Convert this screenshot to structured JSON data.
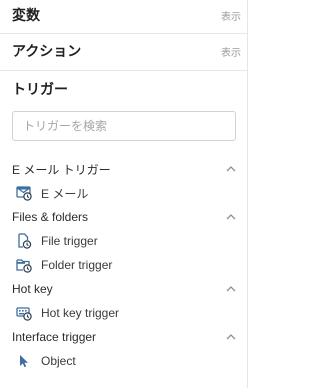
{
  "sections": {
    "variables": {
      "title": "変数",
      "toggle": "表示"
    },
    "actions": {
      "title": "アクション",
      "toggle": "表示"
    },
    "triggers": {
      "title": "トリガー"
    }
  },
  "search": {
    "placeholder": "トリガーを検索"
  },
  "groups": [
    {
      "title": "E メール トリガー",
      "items": [
        {
          "label": "E メール",
          "icon": "email-trigger-icon"
        }
      ]
    },
    {
      "title": "Files & folders",
      "items": [
        {
          "label": "File trigger",
          "icon": "file-trigger-icon"
        },
        {
          "label": "Folder trigger",
          "icon": "folder-trigger-icon"
        }
      ]
    },
    {
      "title": "Hot key",
      "items": [
        {
          "label": "Hot key trigger",
          "icon": "hotkey-trigger-icon"
        }
      ]
    },
    {
      "title": "Interface trigger",
      "items": [
        {
          "label": "Object",
          "icon": "object-trigger-icon"
        }
      ]
    }
  ],
  "colors": {
    "icon_primary": "#3c6e9f",
    "icon_dark": "#2d3e50",
    "chevron": "#8a9099"
  }
}
